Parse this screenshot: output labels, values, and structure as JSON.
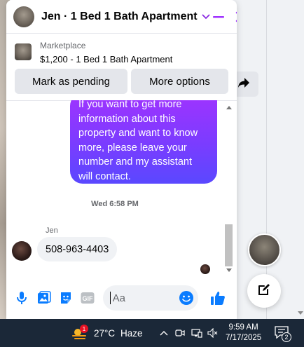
{
  "chat": {
    "title": "Jen · 1 Bed 1 Bath Apartment",
    "marketplace_label": "Marketplace",
    "listing": "$1,200 - 1 Bed 1 Bath Apartment",
    "buttons": {
      "mark_pending": "Mark as pending",
      "more_options": "More options"
    },
    "outgoing_message": "If you want to get more information about this property and want to know more, please leave your number and my assistant will contact.",
    "timestamp": "Wed 6:58 PM",
    "sender": "Jen",
    "incoming_message": "508-963-4403",
    "composer": {
      "placeholder": "Aa"
    },
    "colors": {
      "accent": "#a033ff",
      "bubble_gradient_end": "#5a48ff",
      "messenger_blue": "#0a7cff"
    }
  },
  "icons": {
    "header": [
      "chevron-down-icon",
      "minimize-icon",
      "close-icon"
    ],
    "composer": [
      "microphone-icon",
      "photo-icon",
      "sticker-icon",
      "gif-icon",
      "emoji-icon",
      "thumbs-up-icon"
    ]
  },
  "taskbar": {
    "weather_badge": "1",
    "temperature": "27°C",
    "condition": "Haze",
    "time": "9:59 AM",
    "date": "7/17/2025",
    "notification_count": "2"
  }
}
